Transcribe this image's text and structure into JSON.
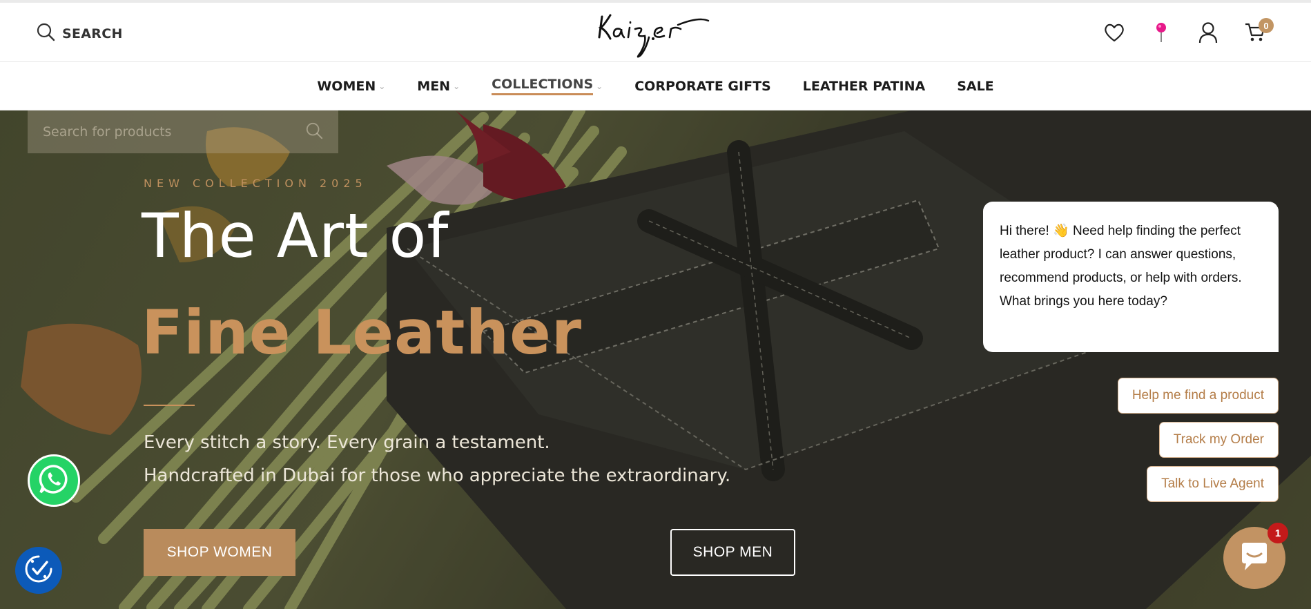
{
  "header": {
    "search_label": "SEARCH",
    "logo_text": "Kaizer",
    "cart_count": "0"
  },
  "nav": {
    "items": [
      {
        "label": "WOMEN",
        "has_dropdown": true
      },
      {
        "label": "MEN",
        "has_dropdown": true
      },
      {
        "label": "COLLECTIONS",
        "has_dropdown": true,
        "active": true
      },
      {
        "label": "CORPORATE GIFTS",
        "has_dropdown": false
      },
      {
        "label": "LEATHER PATINA",
        "has_dropdown": false
      },
      {
        "label": "SALE",
        "has_dropdown": false
      }
    ],
    "dropdown_chevron": "⌄"
  },
  "search_dropdown": {
    "placeholder": "Search for products"
  },
  "hero": {
    "eyebrow": "NEW COLLECTION 2025",
    "headline_line1": "The Art of",
    "headline_line2": "Fine Leather",
    "tagline_line1": "Every stitch a story. Every grain a testament.",
    "tagline_line2": "Handcrafted in Dubai for those who appreciate the extraordinary.",
    "button_women": "SHOP WOMEN",
    "button_men": "SHOP MEN"
  },
  "chat": {
    "greeting": "Hi there! 👋 Need help finding the perfect leather product? I can answer questions, recommend products, or help with orders. What brings you here today?",
    "quick_replies": [
      "Help me find a product",
      "Track my Order",
      "Talk to Live Agent"
    ],
    "unread_count": "1"
  },
  "colors": {
    "accent": "#c29563",
    "headline_gold": "#c9925c",
    "chat_reply_text": "#b47d48",
    "whatsapp": "#25d366",
    "accessibility": "#0c5ab9",
    "badge_red": "#c41a1a"
  },
  "icons": {
    "search": "search-icon",
    "wishlist": "heart-icon",
    "location": "map-pin-icon",
    "account": "user-icon",
    "cart": "cart-icon",
    "whatsapp": "whatsapp-icon",
    "accessibility": "accessibility-icon",
    "chat": "chat-icon"
  }
}
